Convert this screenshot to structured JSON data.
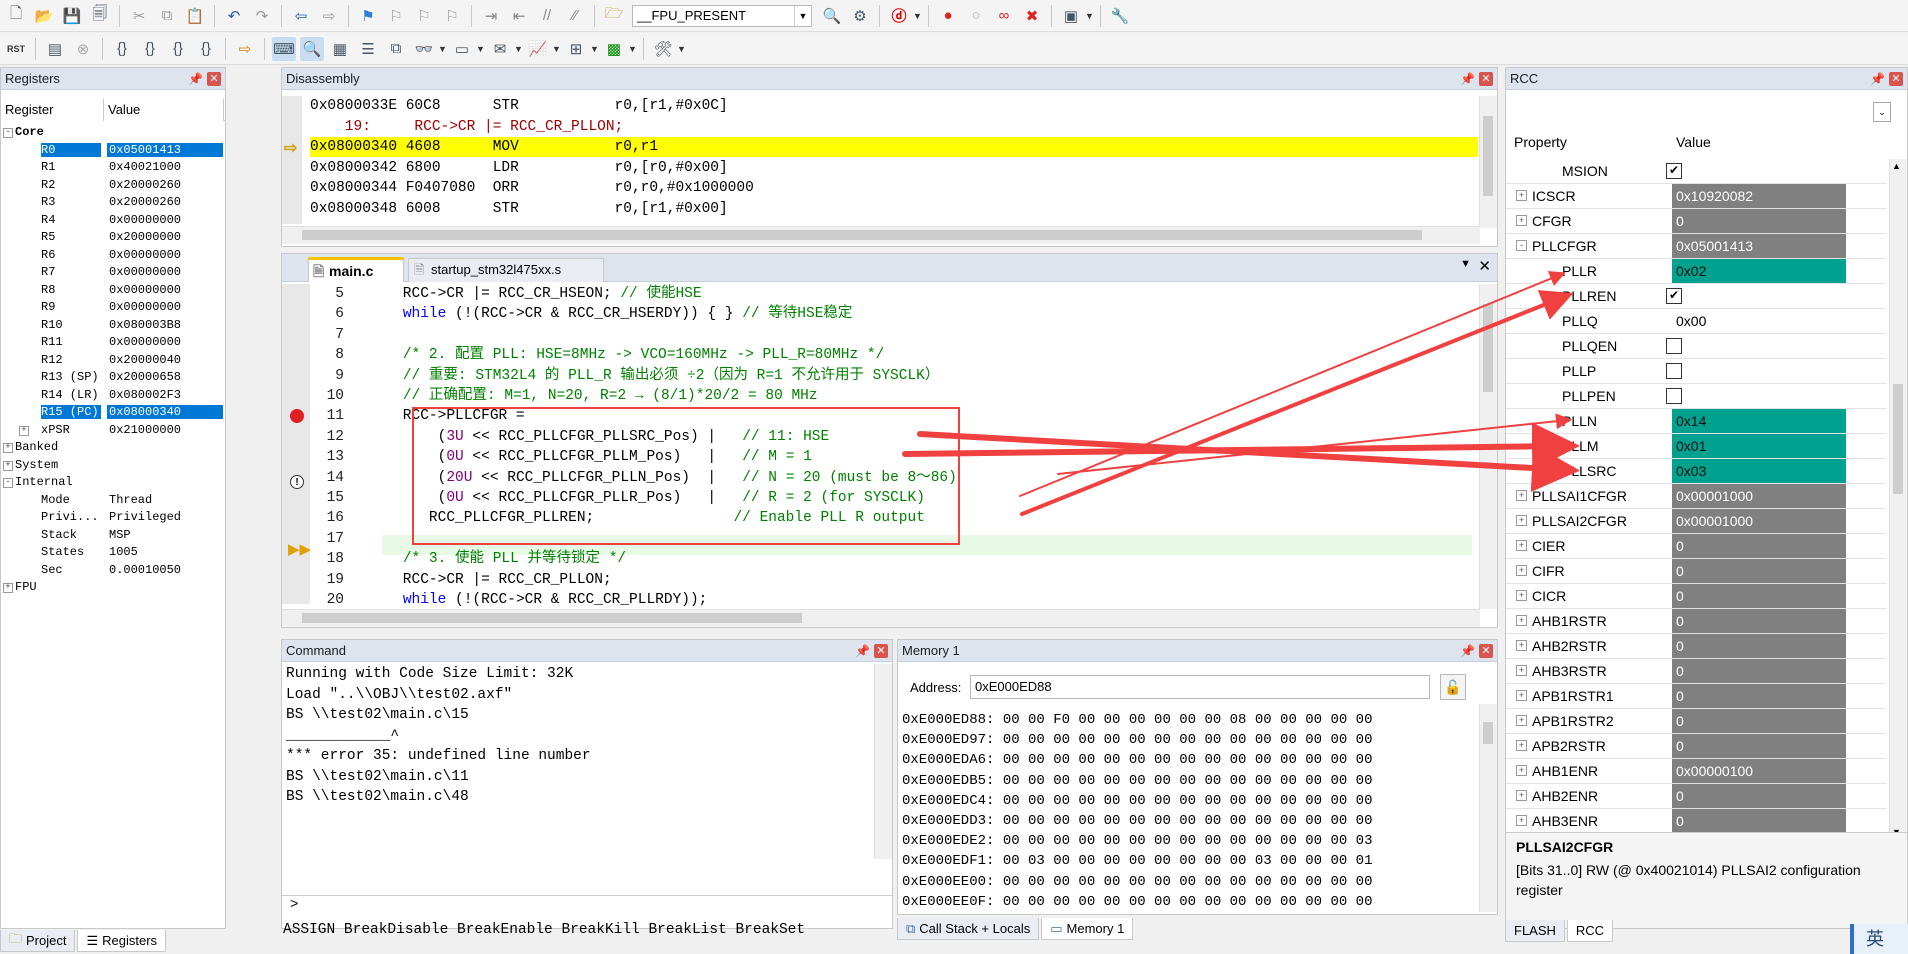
{
  "toolbar1": {
    "target_combo": "__FPU_PRESENT"
  },
  "registers_panel": {
    "title": "Registers",
    "col_register": "Register",
    "col_value": "Value",
    "rows": [
      {
        "name": "Core",
        "value": "",
        "indent": 0,
        "expand": "-",
        "bold": true
      },
      {
        "name": "R0",
        "value": "0x05001413",
        "indent": 2,
        "selected": true
      },
      {
        "name": "R1",
        "value": "0x40021000",
        "indent": 2
      },
      {
        "name": "R2",
        "value": "0x20000260",
        "indent": 2
      },
      {
        "name": "R3",
        "value": "0x20000260",
        "indent": 2
      },
      {
        "name": "R4",
        "value": "0x00000000",
        "indent": 2
      },
      {
        "name": "R5",
        "value": "0x20000000",
        "indent": 2
      },
      {
        "name": "R6",
        "value": "0x00000000",
        "indent": 2
      },
      {
        "name": "R7",
        "value": "0x00000000",
        "indent": 2
      },
      {
        "name": "R8",
        "value": "0x00000000",
        "indent": 2
      },
      {
        "name": "R9",
        "value": "0x00000000",
        "indent": 2
      },
      {
        "name": "R10",
        "value": "0x080003B8",
        "indent": 2
      },
      {
        "name": "R11",
        "value": "0x00000000",
        "indent": 2
      },
      {
        "name": "R12",
        "value": "0x20000040",
        "indent": 2
      },
      {
        "name": "R13 (SP)",
        "value": "0x20000658",
        "indent": 2
      },
      {
        "name": "R14 (LR)",
        "value": "0x080002F3",
        "indent": 2
      },
      {
        "name": "R15 (PC)",
        "value": "0x08000340",
        "indent": 2,
        "selected": true
      },
      {
        "name": "xPSR",
        "value": "0x21000000",
        "indent": 2,
        "expand": "+"
      },
      {
        "name": "Banked",
        "value": "",
        "indent": 0,
        "expand": "+"
      },
      {
        "name": "System",
        "value": "",
        "indent": 0,
        "expand": "+"
      },
      {
        "name": "Internal",
        "value": "",
        "indent": 0,
        "expand": "-"
      },
      {
        "name": "Mode",
        "value": "Thread",
        "indent": 2
      },
      {
        "name": "Privi...",
        "value": "Privileged",
        "indent": 2
      },
      {
        "name": "Stack",
        "value": "MSP",
        "indent": 2
      },
      {
        "name": "States",
        "value": "1005",
        "indent": 2
      },
      {
        "name": "Sec",
        "value": "0.00010050",
        "indent": 2
      },
      {
        "name": "FPU",
        "value": "",
        "indent": 0,
        "expand": "+"
      }
    ],
    "tab_project": "Project",
    "tab_registers": "Registers"
  },
  "disassembly": {
    "title": "Disassembly",
    "lines": [
      {
        "text": "0x0800033E 60C8      STR           r0,[r1,#0x0C]",
        "kind": "asm"
      },
      {
        "text": "    19:     RCC->CR |= RCC_CR_PLLON;",
        "kind": "src"
      },
      {
        "text": "0x08000340 4608      MOV           r0,r1",
        "kind": "current"
      },
      {
        "text": "0x08000342 6800      LDR           r0,[r0,#0x00]",
        "kind": "asm"
      },
      {
        "text": "0x08000344 F0407080  ORR           r0,r0,#0x1000000",
        "kind": "asm"
      },
      {
        "text": "0x08000348 6008      STR           r0,[r1,#0x00]",
        "kind": "asm"
      }
    ]
  },
  "editor": {
    "tabs": [
      "main.c",
      "startup_stm32l475xx.s"
    ],
    "lines": [
      {
        "no": "5",
        "html": "    RCC->CR |= RCC_CR_HSEON; <span class=\"cm\">// 使能HSE</span>"
      },
      {
        "no": "6",
        "html": "    <span class=\"kw\">while</span> (!(RCC->CR &amp; RCC_CR_HSERDY)) { } <span class=\"cm\">// 等待HSE稳定</span>"
      },
      {
        "no": "7",
        "html": ""
      },
      {
        "no": "8",
        "html": "    <span class=\"cm\">/* 2. 配置 PLL: HSE=8MHz -> VCO=160MHz -> PLL_R=80MHz */</span>"
      },
      {
        "no": "9",
        "html": "    <span class=\"cm\">// 重要: STM32L4 的 PLL_R 输出必须 ÷2（因为 R=1 不允许用于 SYSCLK）</span>"
      },
      {
        "no": "10",
        "html": "    <span class=\"cm\">// 正确配置: M=1, N=20, R=2 → (8/1)*20/2 = 80 MHz</span>"
      },
      {
        "no": "11",
        "html": "    RCC->PLLCFGR ="
      },
      {
        "no": "12",
        "html": "        (<span class=\"num\">3U</span> << RCC_PLLCFGR_PLLSRC_Pos) |   <span class=\"cm\">// 11: HSE</span>"
      },
      {
        "no": "13",
        "html": "        (<span class=\"num\">0U</span> << RCC_PLLCFGR_PLLM_Pos)   |   <span class=\"cm\">// M = 1</span>"
      },
      {
        "no": "14",
        "html": "        (<span class=\"num\">20U</span> << RCC_PLLCFGR_PLLN_Pos)  |   <span class=\"cm\">// N = 20 (must be 8～86)</span>"
      },
      {
        "no": "15",
        "html": "        (<span class=\"num\">0U</span> << RCC_PLLCFGR_PLLR_Pos)   |   <span class=\"cm\">// R = 2 (for SYSCLK)</span>"
      },
      {
        "no": "16",
        "html": "       RCC_PLLCFGR_PLLREN;                <span class=\"cm\">// Enable PLL R output</span>"
      },
      {
        "no": "17",
        "html": ""
      },
      {
        "no": "18",
        "html": "    <span class=\"cm\">/* 3. 使能 PLL 并等待锁定 */</span>"
      },
      {
        "no": "19",
        "html": "    RCC->CR |= RCC_CR_PLLON;"
      },
      {
        "no": "20",
        "html": "    <span class=\"kw\">while</span> (!(RCC->CR &amp; RCC_CR_PLLRDY));"
      }
    ]
  },
  "command": {
    "title": "Command",
    "lines": [
      "Running with Code Size Limit: 32K",
      "Load \"..\\\\OBJ\\\\test02.axf\"",
      "BS \\\\test02\\main.c\\15",
      "____________^",
      "*** error 35: undefined line number",
      "BS \\\\test02\\main.c\\11",
      "BS \\\\test02\\main.c\\48"
    ],
    "prompt": ">",
    "hints": "ASSIGN BreakDisable BreakEnable BreakKill BreakList BreakSet"
  },
  "memory": {
    "title": "Memory 1",
    "address_label": "Address:",
    "address_value": "0xE000ED88",
    "lines": [
      "0xE000ED88: 00 00 F0 00 00 00 00 00 00 08 00 00 00 00 00",
      "0xE000ED97: 00 00 00 00 00 00 00 00 00 00 00 00 00 00 00",
      "0xE000EDA6: 00 00 00 00 00 00 00 00 00 00 00 00 00 00 00",
      "0xE000EDB5: 00 00 00 00 00 00 00 00 00 00 00 00 00 00 00",
      "0xE000EDC4: 00 00 00 00 00 00 00 00 00 00 00 00 00 00 00",
      "0xE000EDD3: 00 00 00 00 00 00 00 00 00 00 00 00 00 00 00",
      "0xE000EDE2: 00 00 00 00 00 00 00 00 00 00 00 00 00 00 03",
      "0xE000EDF1: 00 03 00 00 00 00 00 00 00 00 03 00 00 00 01",
      "0xE000EE00: 00 00 00 00 00 00 00 00 00 00 00 00 00 00 00",
      "0xE000EE0F: 00 00 00 00 00 00 00 00 00 00 00 00 00 00 00"
    ],
    "tab_callstack": "Call Stack + Locals",
    "tab_memory": "Memory 1"
  },
  "rcc": {
    "title": "RCC",
    "col_property": "Property",
    "col_value": "Value",
    "rows": [
      {
        "name": "MSION",
        "type": "check",
        "checked": true,
        "level": 2
      },
      {
        "name": "ICSCR",
        "type": "gray",
        "value": "0x10920082",
        "expand": "+",
        "level": 1
      },
      {
        "name": "CFGR",
        "type": "gray",
        "value": "0",
        "expand": "+",
        "level": 1
      },
      {
        "name": "PLLCFGR",
        "type": "gray",
        "value": "0x05001413",
        "expand": "-",
        "level": 1
      },
      {
        "name": "PLLR",
        "type": "teal",
        "value": "0x02",
        "level": 2
      },
      {
        "name": "PLLREN",
        "type": "check",
        "checked": true,
        "level": 2
      },
      {
        "name": "PLLQ",
        "type": "white",
        "value": "0x00",
        "level": 2
      },
      {
        "name": "PLLQEN",
        "type": "check",
        "checked": false,
        "level": 2
      },
      {
        "name": "PLLP",
        "type": "check",
        "checked": false,
        "level": 2
      },
      {
        "name": "PLLPEN",
        "type": "check",
        "checked": false,
        "level": 2
      },
      {
        "name": "PLLN",
        "type": "teal",
        "value": "0x14",
        "level": 2
      },
      {
        "name": "PLLM",
        "type": "teal",
        "value": "0x01",
        "level": 2
      },
      {
        "name": "PLLSRC",
        "type": "teal",
        "value": "0x03",
        "level": 2
      },
      {
        "name": "PLLSAI1CFGR",
        "type": "gray",
        "value": "0x00001000",
        "expand": "+",
        "level": 1
      },
      {
        "name": "PLLSAI2CFGR",
        "type": "gray",
        "value": "0x00001000",
        "expand": "+",
        "level": 1
      },
      {
        "name": "CIER",
        "type": "gray",
        "value": "0",
        "expand": "+",
        "level": 1
      },
      {
        "name": "CIFR",
        "type": "gray",
        "value": "0",
        "expand": "+",
        "level": 1
      },
      {
        "name": "CICR",
        "type": "gray",
        "value": "0",
        "expand": "+",
        "level": 1
      },
      {
        "name": "AHB1RSTR",
        "type": "gray",
        "value": "0",
        "expand": "+",
        "level": 1
      },
      {
        "name": "AHB2RSTR",
        "type": "gray",
        "value": "0",
        "expand": "+",
        "level": 1
      },
      {
        "name": "AHB3RSTR",
        "type": "gray",
        "value": "0",
        "expand": "+",
        "level": 1
      },
      {
        "name": "APB1RSTR1",
        "type": "gray",
        "value": "0",
        "expand": "+",
        "level": 1
      },
      {
        "name": "APB1RSTR2",
        "type": "gray",
        "value": "0",
        "expand": "+",
        "level": 1
      },
      {
        "name": "APB2RSTR",
        "type": "gray",
        "value": "0",
        "expand": "+",
        "level": 1
      },
      {
        "name": "AHB1ENR",
        "type": "gray",
        "value": "0x00000100",
        "expand": "+",
        "level": 1
      },
      {
        "name": "AHB2ENR",
        "type": "gray",
        "value": "0",
        "expand": "+",
        "level": 1
      },
      {
        "name": "AHB3ENR",
        "type": "gray",
        "value": "0",
        "expand": "+",
        "level": 1
      }
    ],
    "desc_title": "PLLSAI2CFGR",
    "desc_text": "[Bits 31..0] RW (@ 0x40021014) PLLSAI2 configuration register",
    "tab_flash": "FLASH",
    "tab_rcc": "RCC"
  },
  "ime_indicator": "英",
  "colors": {
    "current_line": "#ffff00",
    "selection": "#0078d7",
    "teal": "#00a28f",
    "gray_value": "#808080",
    "annotation_red": "#f04040"
  }
}
